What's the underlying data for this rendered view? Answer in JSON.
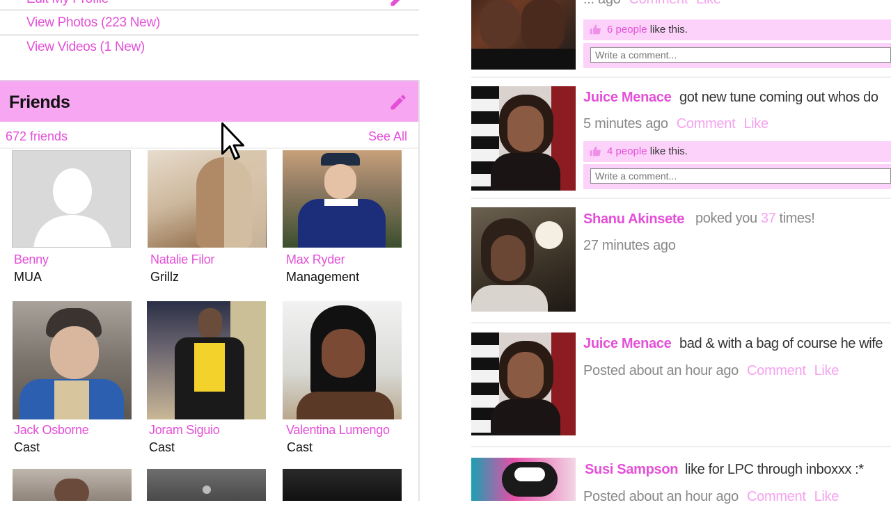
{
  "profile_links": {
    "edit_profile": "Edit My Profile",
    "view_photos": "View Photos (223 New)",
    "view_videos": "View Videos (1 New)"
  },
  "friends": {
    "title": "Friends",
    "count": "672 friends",
    "see_all": "See All",
    "items": [
      {
        "name": "Benny",
        "role": "MUA"
      },
      {
        "name": "Natalie Filor",
        "role": "Grillz"
      },
      {
        "name": "Max Ryder",
        "role": "Management"
      },
      {
        "name": "Jack Osborne",
        "role": "Cast"
      },
      {
        "name": "Joram Siguio",
        "role": "Cast"
      },
      {
        "name": "Valentina Lumengo",
        "role": "Cast"
      }
    ]
  },
  "feed": [
    {
      "meta": "... ago",
      "comment": "Comment",
      "like": "Like",
      "likes_count": "6 people",
      "likes_suffix": " like this.",
      "comment_placeholder": "Write a comment..."
    },
    {
      "poster": "Juice Menace",
      "text": "got new tune coming out whos do",
      "meta": "5 minutes ago",
      "comment": "Comment",
      "like": "Like",
      "likes_count": "4 people",
      "likes_suffix": " like this.",
      "comment_placeholder": "Write a comment..."
    },
    {
      "poster": "Shanu Akinsete",
      "text_before": "poked you ",
      "poke_count": "37",
      "text_after": " times!",
      "meta": "27 minutes ago"
    },
    {
      "poster": "Juice Menace",
      "text": "bad & with a bag of course he wife",
      "meta": "Posted about an hour ago",
      "comment": "Comment",
      "like": "Like"
    },
    {
      "poster": "Susi Sampson",
      "text": "like for LPC through inboxxx :*",
      "meta": "Posted about an hour ago",
      "comment": "Comment",
      "like": "Like"
    }
  ],
  "colors": {
    "accent": "#e44fd8",
    "header_bg": "#f7a6f1",
    "likes_bg": "#fcd2fa",
    "action_pink": "#f5a2ef"
  },
  "icons": [
    "pencil-icon",
    "thumbs-up-icon",
    "cursor-icon",
    "avatar-placeholder-icon"
  ]
}
